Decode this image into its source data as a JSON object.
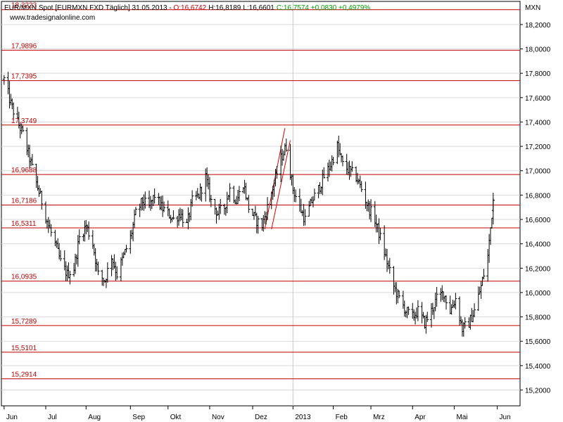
{
  "header": {
    "instrument": "EUR/MXN Spot [EURMXN FXD  Täglich] 31.05.2013 - ",
    "open": "O:16,6742",
    "high": "H:16,8189",
    "low": "L:16,6601",
    "close": "C:16,7574 +0,0830 +0,4979%",
    "colors": {
      "text": "#000000",
      "open": "#d00000",
      "close": "#00a000"
    }
  },
  "watermark": "www.tradesignalonline.com",
  "currency_label": "MXN",
  "chart_data": {
    "type": "ohlc",
    "title": "EUR/MXN Spot [EURMXN FXD  Täglich] 31.05.2013",
    "ylabel": "MXN",
    "ylim": [
      15.07,
      18.39
    ],
    "y_ticks": [
      "15,2000",
      "15,4000",
      "15,6000",
      "15,8000",
      "16,0000",
      "16,2000",
      "16,4000",
      "16,6000",
      "16,8000",
      "17,0000",
      "17,2000",
      "17,4000",
      "17,6000",
      "17,8000",
      "18,0000",
      "18,2000"
    ],
    "y_tick_values": [
      15.2,
      15.4,
      15.6,
      15.8,
      16.0,
      16.2,
      16.4,
      16.6,
      16.8,
      17.0,
      17.2,
      17.4,
      17.6,
      17.8,
      18.0,
      18.2
    ],
    "x_tick_labels": [
      "Jun",
      "Jul",
      "Aug",
      "Sep",
      "Okt",
      "Nov",
      "Dez",
      "2013",
      "Feb",
      "Mrz",
      "Apr",
      "Mai",
      "Jun"
    ],
    "x_tick_dates": [
      "2012-06-01",
      "2012-07-02",
      "2012-08-01",
      "2012-09-03",
      "2012-10-01",
      "2012-11-01",
      "2012-12-03",
      "2013-01-02",
      "2013-02-01",
      "2013-03-01",
      "2013-04-01",
      "2013-05-02",
      "2013-06-03"
    ],
    "x_range": [
      "2012-05-30",
      "2013-06-20"
    ],
    "levels": [
      {
        "value": 18.3223,
        "label": "18,3223"
      },
      {
        "value": 17.9896,
        "label": "17,9896"
      },
      {
        "value": 17.7395,
        "label": "17,7395"
      },
      {
        "value": 17.3749,
        "label": "17,3749"
      },
      {
        "value": 16.9688,
        "label": "16,9688"
      },
      {
        "value": 16.7186,
        "label": "16,7186"
      },
      {
        "value": 16.5311,
        "label": "16,5311"
      },
      {
        "value": 16.0935,
        "label": "16,0935"
      },
      {
        "value": 15.7289,
        "label": "15,7289"
      },
      {
        "value": 15.5101,
        "label": "15,5101"
      },
      {
        "value": 15.2914,
        "label": "15,2914"
      }
    ],
    "trendlines": [
      {
        "from": [
          "2012-12-12",
          16.52
        ],
        "to": [
          "2012-12-27",
          17.35
        ]
      },
      {
        "from": [
          "2012-12-17",
          16.52
        ],
        "to": [
          "2012-12-31",
          17.25
        ]
      }
    ],
    "close_path": [
      [
        "2012-06-01",
        17.75
      ],
      [
        "2012-06-06",
        17.55
      ],
      [
        "2012-06-11",
        17.4
      ],
      [
        "2012-06-15",
        17.3
      ],
      [
        "2012-06-20",
        17.1
      ],
      [
        "2012-06-25",
        16.9
      ],
      [
        "2012-06-29",
        16.75
      ],
      [
        "2012-07-04",
        16.55
      ],
      [
        "2012-07-09",
        16.4
      ],
      [
        "2012-07-13",
        16.25
      ],
      [
        "2012-07-18",
        16.15
      ],
      [
        "2012-07-23",
        16.2
      ],
      [
        "2012-07-27",
        16.45
      ],
      [
        "2012-08-01",
        16.55
      ],
      [
        "2012-08-06",
        16.4
      ],
      [
        "2012-08-10",
        16.15
      ],
      [
        "2012-08-15",
        16.1
      ],
      [
        "2012-08-20",
        16.3
      ],
      [
        "2012-08-24",
        16.15
      ],
      [
        "2012-08-29",
        16.3
      ],
      [
        "2012-09-03",
        16.45
      ],
      [
        "2012-09-07",
        16.65
      ],
      [
        "2012-09-12",
        16.75
      ],
      [
        "2012-09-17",
        16.7
      ],
      [
        "2012-09-21",
        16.8
      ],
      [
        "2012-09-26",
        16.7
      ],
      [
        "2012-10-01",
        16.65
      ],
      [
        "2012-10-05",
        16.6
      ],
      [
        "2012-10-10",
        16.65
      ],
      [
        "2012-10-15",
        16.55
      ],
      [
        "2012-10-19",
        16.75
      ],
      [
        "2012-10-24",
        16.8
      ],
      [
        "2012-10-29",
        16.95
      ],
      [
        "2012-11-02",
        16.75
      ],
      [
        "2012-11-07",
        16.65
      ],
      [
        "2012-11-12",
        16.7
      ],
      [
        "2012-11-16",
        16.85
      ],
      [
        "2012-11-21",
        16.75
      ],
      [
        "2012-11-26",
        16.9
      ],
      [
        "2012-11-30",
        16.7
      ],
      [
        "2012-12-05",
        16.6
      ],
      [
        "2012-12-10",
        16.55
      ],
      [
        "2012-12-14",
        16.7
      ],
      [
        "2012-12-19",
        16.9
      ],
      [
        "2012-12-24",
        17.1
      ],
      [
        "2012-12-28",
        17.2
      ],
      [
        "2013-01-02",
        16.85
      ],
      [
        "2013-01-07",
        16.7
      ],
      [
        "2013-01-11",
        16.6
      ],
      [
        "2013-01-16",
        16.75
      ],
      [
        "2013-01-21",
        16.85
      ],
      [
        "2013-01-25",
        16.95
      ],
      [
        "2013-01-30",
        17.05
      ],
      [
        "2013-02-04",
        17.2
      ],
      [
        "2013-02-08",
        17.05
      ],
      [
        "2013-02-13",
        17.0
      ],
      [
        "2013-02-18",
        16.95
      ],
      [
        "2013-02-22",
        16.85
      ],
      [
        "2013-02-27",
        16.7
      ],
      [
        "2013-03-04",
        16.6
      ],
      [
        "2013-03-08",
        16.45
      ],
      [
        "2013-03-13",
        16.25
      ],
      [
        "2013-03-18",
        16.05
      ],
      [
        "2013-03-22",
        15.95
      ],
      [
        "2013-03-27",
        15.85
      ],
      [
        "2013-04-01",
        15.8
      ],
      [
        "2013-04-05",
        15.85
      ],
      [
        "2013-04-10",
        15.75
      ],
      [
        "2013-04-15",
        15.85
      ],
      [
        "2013-04-19",
        15.95
      ],
      [
        "2013-04-24",
        16.0
      ],
      [
        "2013-04-29",
        15.85
      ],
      [
        "2013-05-03",
        15.95
      ],
      [
        "2013-05-08",
        15.7
      ],
      [
        "2013-05-13",
        15.75
      ],
      [
        "2013-05-17",
        15.85
      ],
      [
        "2013-05-22",
        16.05
      ],
      [
        "2013-05-27",
        16.3
      ],
      [
        "2013-05-31",
        16.76
      ]
    ],
    "last_bar": {
      "date": "2013-05-31",
      "open": 16.6742,
      "high": 16.8189,
      "low": 16.6601,
      "close": 16.7574
    }
  }
}
